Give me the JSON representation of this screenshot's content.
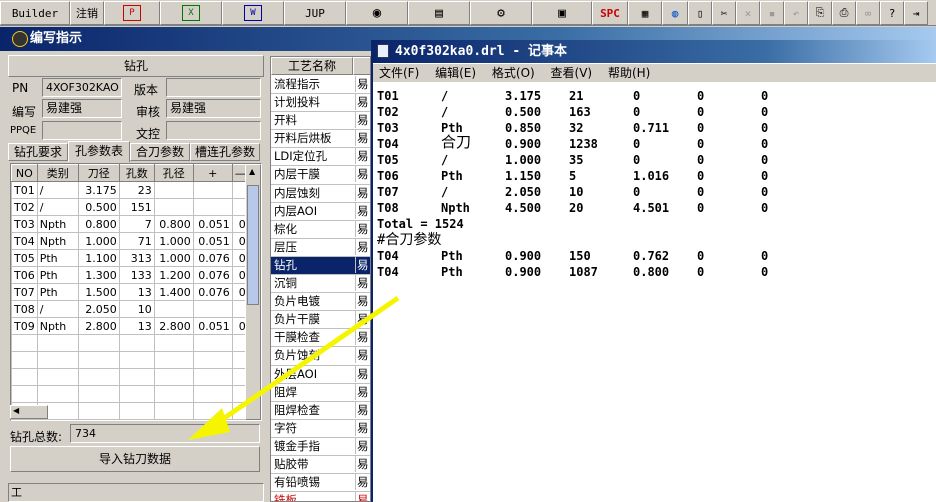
{
  "toolbar": {
    "builder": "Builder",
    "logout": "注销",
    "jup": "JUP",
    "spc": "SPC"
  },
  "main_title": "编写指示",
  "drill_panel": {
    "header": "钻孔",
    "pn_label": "PN",
    "pn_value": "4XOF302KAO",
    "version_label": "版本",
    "version_value": "",
    "writer_label": "编写",
    "writer_value": "易建强",
    "reviewer_label": "审核",
    "reviewer_value": "易建强",
    "ppqe_label": "PPQE",
    "ppqe_value": "",
    "docctrl_label": "文控",
    "docctrl_value": "",
    "tabs": [
      "钻孔要求",
      "孔参数表",
      "合刀参数",
      "槽连孔参数"
    ],
    "active_tab": 1,
    "columns": [
      "NO",
      "类别",
      "刀径",
      "孔数",
      "孔径",
      "+",
      "—"
    ],
    "rows": [
      [
        "T01",
        "/",
        "3.175",
        "23",
        "",
        "",
        ""
      ],
      [
        "T02",
        "/",
        "0.500",
        "151",
        "",
        "",
        ""
      ],
      [
        "T03",
        "Npth",
        "0.800",
        "7",
        "0.800",
        "0.051",
        "0"
      ],
      [
        "T04",
        "Npth",
        "1.000",
        "71",
        "1.000",
        "0.051",
        "0"
      ],
      [
        "T05",
        "Pth",
        "1.100",
        "313",
        "1.000",
        "0.076",
        "0"
      ],
      [
        "T06",
        "Pth",
        "1.300",
        "133",
        "1.200",
        "0.076",
        "0"
      ],
      [
        "T07",
        "Pth",
        "1.500",
        "13",
        "1.400",
        "0.076",
        "0"
      ],
      [
        "T08",
        "/",
        "2.050",
        "10",
        "",
        "",
        ""
      ],
      [
        "T09",
        "Npth",
        "2.800",
        "13",
        "2.800",
        "0.051",
        "0"
      ]
    ],
    "total_label": "钻孔总数:",
    "total_value": "734",
    "import_button": "导入钻刀数据",
    "bottom_label": "工"
  },
  "process_list": {
    "header": "工艺名称",
    "items": [
      "流程指示",
      "计划投料",
      "开料",
      "开料后烘板",
      "LDI定位孔",
      "内层干膜",
      "内层蚀刻",
      "内层AOI",
      "棕化",
      "层压",
      "钻孔",
      "沉铜",
      "负片电镀",
      "负片干膜",
      "干膜检查",
      "负片蚀刻",
      "外层AOI",
      "阻焊",
      "阻焊检查",
      "字符",
      "镀金手指",
      "贴胶带",
      "有铅喷锡",
      "铣板"
    ],
    "selected": 10,
    "side_text": "易"
  },
  "notepad": {
    "title": "4x0f302ka0.drl - 记事本",
    "menu": [
      "文件(F)",
      "编辑(E)",
      "格式(O)",
      "查看(V)",
      "帮助(H)"
    ],
    "lines": [
      [
        "T01",
        "/",
        "3.175",
        "21",
        "0",
        "0",
        "0"
      ],
      [
        "T02",
        "/",
        "0.500",
        "163",
        "0",
        "0",
        "0"
      ],
      [
        "T03",
        "Pth",
        "0.850",
        "32",
        "0.711",
        "0",
        "0"
      ],
      [
        "T04",
        "合刀",
        "0.900",
        "1238",
        "0",
        "0",
        "0"
      ],
      [
        "T05",
        "/",
        "1.000",
        "35",
        "0",
        "0",
        "0"
      ],
      [
        "T06",
        "Pth",
        "1.150",
        "5",
        "1.016",
        "0",
        "0"
      ],
      [
        "T07",
        "/",
        "2.050",
        "10",
        "0",
        "0",
        "0"
      ],
      [
        "T08",
        "Npth",
        "4.500",
        "20",
        "4.501",
        "0",
        "0"
      ]
    ],
    "total_line": "Total = 1524",
    "section_line": "#合刀参数",
    "lines2": [
      [
        "T04",
        "Pth",
        "0.900",
        "150",
        "0.762",
        "0",
        "0"
      ],
      [
        "T04",
        "Pth",
        "0.900",
        "1087",
        "0.800",
        "0",
        "0"
      ]
    ]
  },
  "colors": {
    "title_blue": "#0a246a",
    "selected_row": "#0a246a",
    "arrow": "#f5f500",
    "last_item_red": "#cc0000"
  }
}
